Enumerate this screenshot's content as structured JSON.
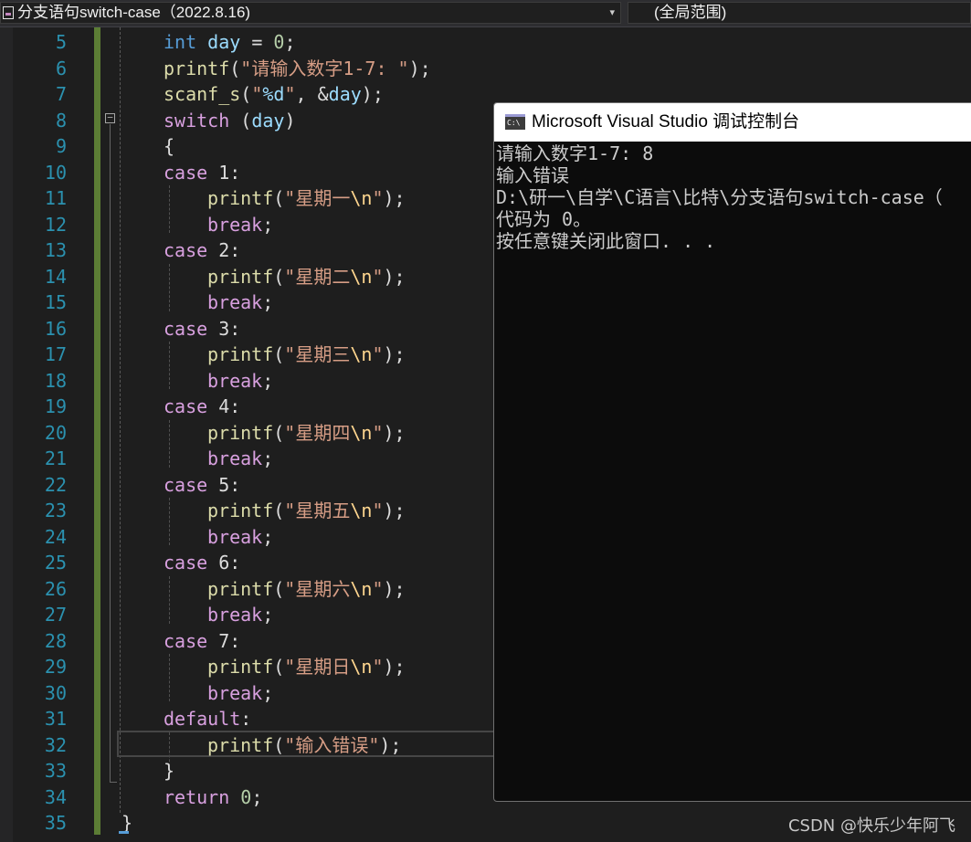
{
  "toolbar": {
    "file_scope": "分支语句switch-case（2022.8.16)",
    "global_scope": "(全局范围)"
  },
  "editor": {
    "line_numbers": [
      "5",
      "6",
      "7",
      "8",
      "9",
      "10",
      "11",
      "12",
      "13",
      "14",
      "15",
      "16",
      "17",
      "18",
      "19",
      "20",
      "21",
      "22",
      "23",
      "24",
      "25",
      "26",
      "27",
      "28",
      "29",
      "30",
      "31",
      "32",
      "33",
      "34",
      "35"
    ],
    "code": {
      "day_decl": {
        "type": "int",
        "name": "day",
        "assign": " = ",
        "value": "0",
        "end": ";"
      },
      "printf_prompt": {
        "fn": "printf",
        "open": "(",
        "str": "\"请输入数字1-7: \"",
        "close": ");"
      },
      "scanf_line": {
        "fn": "scanf_s",
        "open": "(",
        "str_a": "\"",
        "fmt": "%d",
        "str_b": "\"",
        "mid": ", &",
        "var": "day",
        "close": ");"
      },
      "switch_line": {
        "kw": "switch",
        "open": " (",
        "var": "day",
        "close": ")"
      },
      "brace_open": "{",
      "brace_close": "}",
      "case_kw": "case",
      "break_kw": "break",
      "semicolon": ";",
      "printf_fn": "printf",
      "lparen": "(",
      "rparen_semi": ");",
      "quote": "\"",
      "escape_n": "\\n",
      "cases": [
        {
          "label": " 1:",
          "text": "星期一"
        },
        {
          "label": " 2:",
          "text": "星期二"
        },
        {
          "label": " 3:",
          "text": "星期三"
        },
        {
          "label": " 4:",
          "text": "星期四"
        },
        {
          "label": " 5:",
          "text": "星期五"
        },
        {
          "label": " 6:",
          "text": "星期六"
        },
        {
          "label": " 7:",
          "text": "星期日"
        }
      ],
      "default_kw": "default",
      "colon": ":",
      "default_str": "\"输入错误\"",
      "return_kw": "return",
      "return_val": " 0",
      "final_brace": "}"
    }
  },
  "console": {
    "title": "Microsoft Visual Studio 调试控制台",
    "icon_text": "C:\\",
    "lines": [
      "请输入数字1-7: 8",
      "输入错误",
      "D:\\研一\\自学\\C语言\\比特\\分支语句switch-case（",
      "代码为 0。",
      "按任意键关闭此窗口. . ."
    ]
  },
  "watermark": "CSDN @快乐少年阿飞"
}
